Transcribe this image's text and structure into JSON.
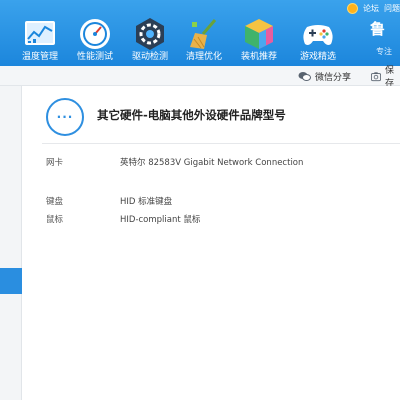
{
  "toolbar": {
    "items": [
      {
        "label": "温度管理",
        "icon": "thermometer-chart-icon"
      },
      {
        "label": "性能测试",
        "icon": "speedometer-icon"
      },
      {
        "label": "驱动检测",
        "icon": "gear-chip-icon"
      },
      {
        "label": "清理优化",
        "icon": "broom-icon"
      },
      {
        "label": "装机推荐",
        "icon": "cube-icon"
      },
      {
        "label": "游戏精选",
        "icon": "gamepad-icon"
      }
    ],
    "top_links": [
      "论坛",
      "问题"
    ],
    "brand_char": "鲁",
    "brand_sub": "专注"
  },
  "subbar": {
    "share_label": "微信分享",
    "save_label": "保存"
  },
  "section": {
    "title": "其它硬件-电脑其他外设硬件品牌型号",
    "more_label": "···"
  },
  "rows": [
    {
      "label": "网卡",
      "value": "英特尔 82583V Gigabit Network Connection"
    },
    {
      "label": "键盘",
      "value": "HID 标准键盘"
    },
    {
      "label": "鼠标",
      "value": "HID-compliant 鼠标"
    }
  ],
  "colors": {
    "accent": "#2e8fe0",
    "toolbar": "#1c86dc"
  }
}
